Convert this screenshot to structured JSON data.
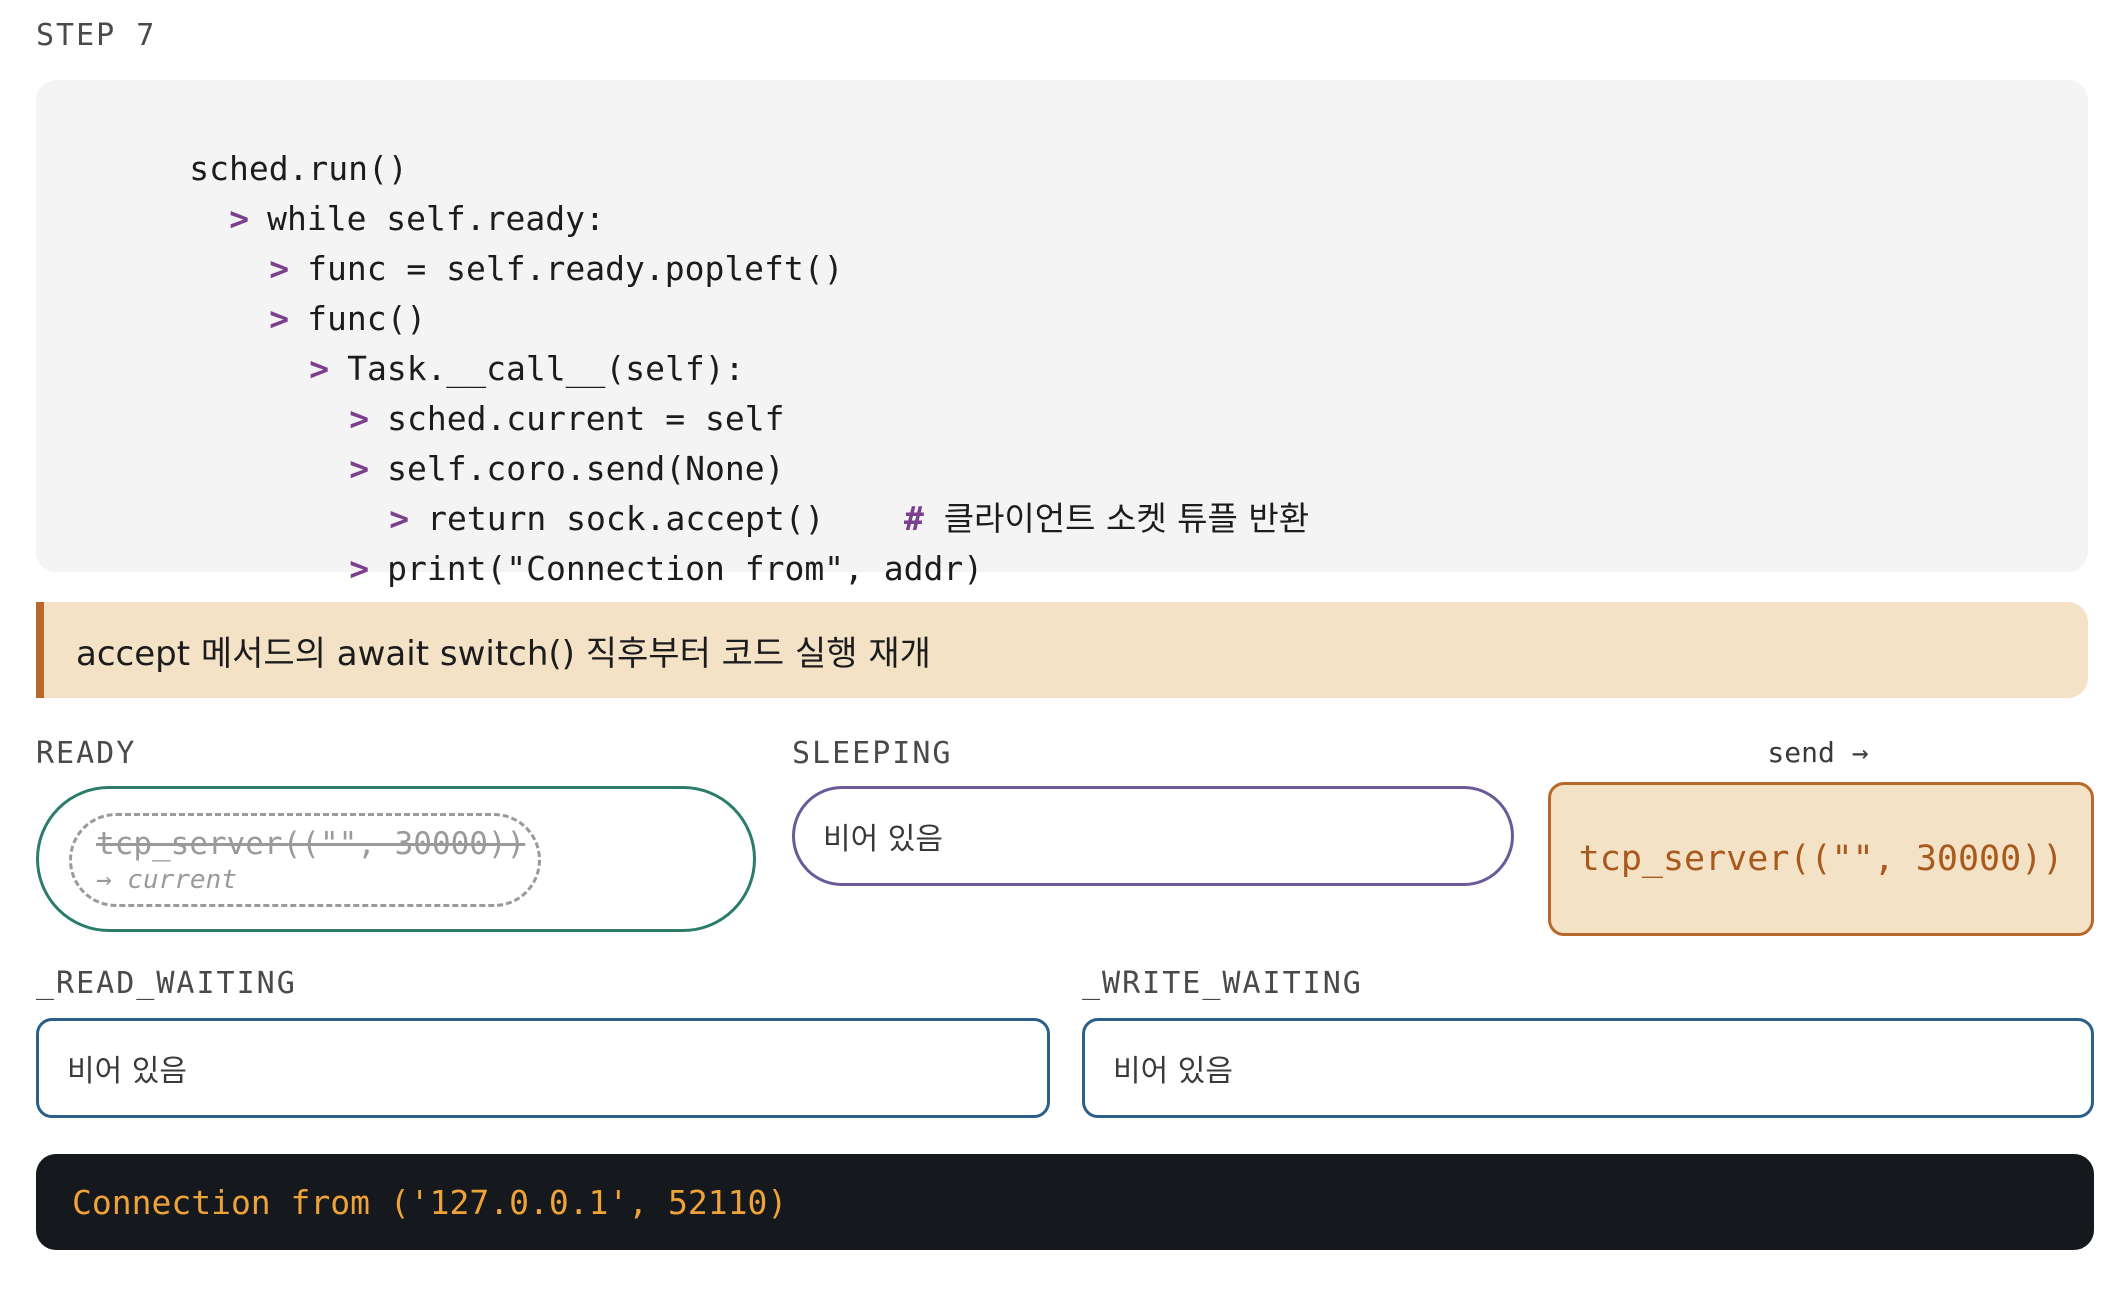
{
  "step_label": "STEP 7",
  "code": {
    "lines": [
      {
        "caret": "",
        "text": "sched.run()"
      },
      {
        "caret": ">",
        "text": "while self.ready:"
      },
      {
        "caret": ">",
        "text": "func = self.ready.popleft()"
      },
      {
        "caret": ">",
        "text": "func()"
      },
      {
        "caret": ">",
        "text": "Task.__call__(self):"
      },
      {
        "caret": ">",
        "text": "sched.current = self"
      },
      {
        "caret": ">",
        "text": "self.coro.send(None)"
      },
      {
        "caret": ">",
        "text": "return sock.accept()",
        "comment_hash": "#",
        "comment_text": "클라이언트 소켓 튜플 반환"
      },
      {
        "caret": ">",
        "text": "print(\"Connection from\", addr)"
      }
    ]
  },
  "note": "accept 메서드의 await switch() 직후부터 코드 실행 재개",
  "ready": {
    "label": "READY",
    "task_name": "tcp_server((\"\", 30000))",
    "task_tag": "→ current"
  },
  "sleeping": {
    "label": "SLEEPING",
    "empty_text": "비어 있음"
  },
  "current": {
    "send_label": "send →",
    "task_name": "tcp_server((\"\", 30000))"
  },
  "read_waiting": {
    "label": "_READ_WAITING",
    "empty_text": "비어 있음"
  },
  "write_waiting": {
    "label": "_WRITE_WAITING",
    "empty_text": "비어 있음"
  },
  "terminal_output": "Connection from ('127.0.0.1', 52110)",
  "colors": {
    "caret": "#7b3f8e",
    "ready_border": "#2c7c6e",
    "sleeping_border": "#6b5a9a",
    "current_fill": "#f4e2c7",
    "current_border": "#b8682a",
    "wait_border": "#2b5f8a",
    "terminal_bg": "#15181c",
    "terminal_text": "#f0a23a"
  }
}
